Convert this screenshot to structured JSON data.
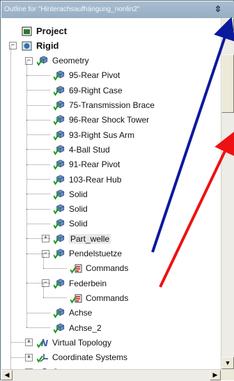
{
  "window": {
    "title": "Outline for \"Hinterachsaufhängung_nonlin2\"",
    "pin_glyph": "⇳"
  },
  "tree": [
    {
      "label": "Project",
      "icon": "project-icon",
      "bold": true
    },
    {
      "label": "Rigid",
      "icon": "model-icon",
      "bold": true,
      "toggle": "−"
    },
    {
      "label": "Geometry",
      "icon": "geometry-icon",
      "toggle": "−"
    },
    {
      "label": "95-Rear Pivot",
      "icon": "part-icon"
    },
    {
      "label": "69-Right Case",
      "icon": "part-icon"
    },
    {
      "label": "75-Transmission Brace",
      "icon": "part-icon"
    },
    {
      "label": "96-Rear Shock Tower",
      "icon": "part-icon"
    },
    {
      "label": "93-Right Sus Arm",
      "icon": "part-icon"
    },
    {
      "label": "4-Ball Stud",
      "icon": "part-icon"
    },
    {
      "label": "91-Rear Pivot",
      "icon": "part-icon"
    },
    {
      "label": "103-Rear Hub",
      "icon": "part-icon"
    },
    {
      "label": "Solid",
      "icon": "part-icon"
    },
    {
      "label": "Solid",
      "icon": "part-icon"
    },
    {
      "label": "Solid",
      "icon": "part-icon"
    },
    {
      "label": "Part_welle",
      "icon": "part-icon",
      "toggle": "+",
      "selected": true
    },
    {
      "label": "Pendelstuetze",
      "icon": "part-icon",
      "toggle": "−"
    },
    {
      "label": "Commands",
      "icon": "commands-icon"
    },
    {
      "label": "Federbein",
      "icon": "part-icon",
      "toggle": "−"
    },
    {
      "label": "Commands",
      "icon": "commands-icon"
    },
    {
      "label": "Achse",
      "icon": "part-icon"
    },
    {
      "label": "Achse_2",
      "icon": "part-icon"
    },
    {
      "label": "Virtual Topology",
      "icon": "virtual-topology-icon",
      "toggle": "+"
    },
    {
      "label": "Coordinate Systems",
      "icon": "coordinate-systems-icon",
      "toggle": "+"
    },
    {
      "label": "Contact",
      "icon": "contact-icon",
      "toggle": "+"
    }
  ],
  "scrollbars": {
    "up": "▲",
    "down": "▼",
    "left": "◀",
    "right": "▶"
  },
  "colors": {
    "arrow_blue": "#0a1a9c",
    "arrow_red": "#ee1111",
    "check_green": "#1a9a1a",
    "title_bar": "#a3b7cb"
  }
}
